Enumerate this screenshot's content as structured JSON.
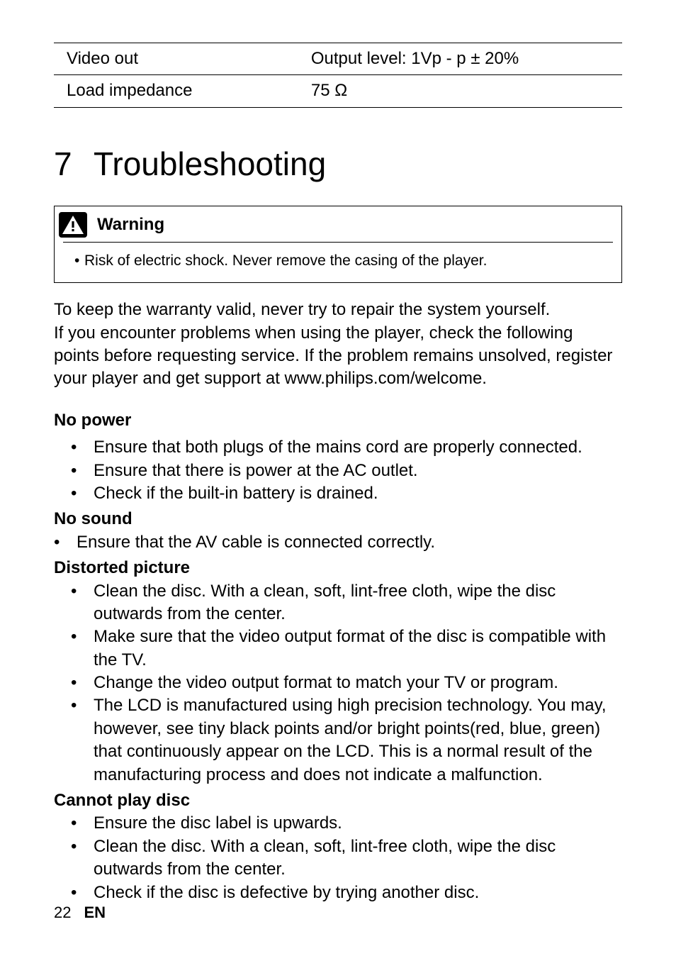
{
  "spec_table": {
    "rows": [
      {
        "label": "Video out",
        "value": "Output level: 1Vp - p ± 20%"
      },
      {
        "label": "Load impedance",
        "value": "75 Ω"
      }
    ]
  },
  "chapter": {
    "number": "7",
    "title": "Troubleshooting"
  },
  "warning": {
    "title": "Warning",
    "text": "Risk of electric shock. Never remove the casing of the player."
  },
  "intro": {
    "line1": "To keep the warranty valid, never try to repair the system yourself.",
    "line2": "If you encounter problems when using the player, check the following points before requesting service. If the problem remains unsolved, register your player and get support at www.philips.com/welcome."
  },
  "sections": {
    "no_power": {
      "title": "No power",
      "items": [
        "Ensure that both plugs of the mains cord are properly connected.",
        "Ensure that there is power at the AC outlet.",
        "Check if the built-in battery is drained."
      ]
    },
    "no_sound": {
      "title": "No sound",
      "items": [
        "Ensure that the AV cable is connected correctly."
      ]
    },
    "distorted_picture": {
      "title": "Distorted picture",
      "items": [
        "Clean the disc. With a clean, soft, lint-free cloth, wipe the disc outwards from the center.",
        "Make sure that the video output format of the disc is compatible with the TV.",
        "Change the video output format to match your TV or program.",
        "The LCD is manufactured using high precision technology. You may, however, see tiny black points and/or bright points(red, blue, green) that continuously appear on the LCD. This is a normal result of the manufacturing process and does not indicate a malfunction."
      ]
    },
    "cannot_play": {
      "title": "Cannot play disc",
      "items": [
        "Ensure the disc label is upwards.",
        "Clean the disc. With a clean, soft, lint-free cloth, wipe the disc outwards from the center.",
        "Check if the disc is defective by trying another disc."
      ]
    }
  },
  "footer": {
    "page": "22",
    "lang": "EN"
  }
}
